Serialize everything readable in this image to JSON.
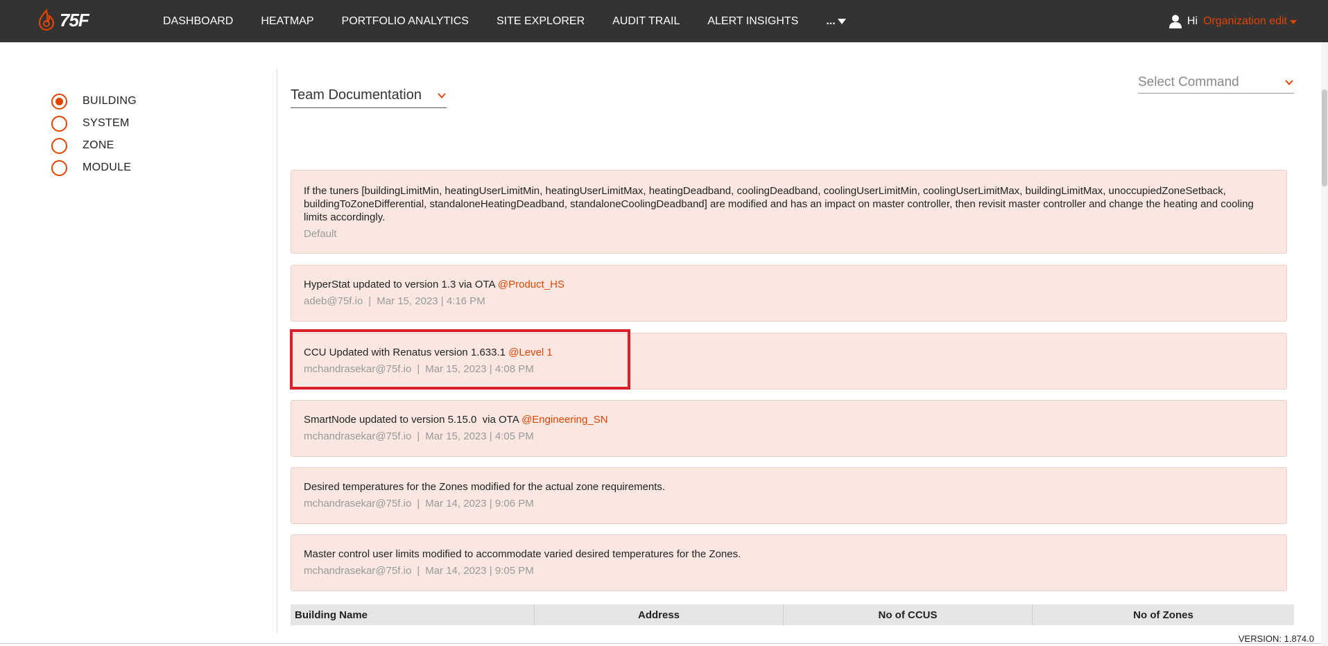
{
  "header": {
    "logo_text": "75F",
    "nav_items": [
      "DASHBOARD",
      "HEATMAP",
      "PORTFOLIO ANALYTICS",
      "SITE EXPLORER",
      "AUDIT TRAIL",
      "ALERT INSIGHTS"
    ],
    "more_label": "...",
    "greeting": "Hi",
    "org_label": "Organization edit"
  },
  "sidebar": {
    "options": [
      {
        "label": "BUILDING",
        "checked": true
      },
      {
        "label": "SYSTEM",
        "checked": false
      },
      {
        "label": "ZONE",
        "checked": false
      },
      {
        "label": "MODULE",
        "checked": false
      }
    ]
  },
  "team_select": {
    "value": "Team Documentation"
  },
  "command_select": {
    "placeholder": "Select Command"
  },
  "notes": [
    {
      "text": "If the tuners [buildingLimitMin, heatingUserLimitMin, heatingUserLimitMax, heatingDeadband, coolingDeadband, coolingUserLimitMin, coolingUserLimitMax, buildingLimitMax, unoccupiedZoneSetback, buildingToZoneDifferential, standaloneHeatingDeadband, standaloneCoolingDeadband] are modified and has an impact on master controller, then revisit master controller and change the heating and cooling limits accordingly.",
      "tag": "",
      "author": "Default",
      "date": ""
    },
    {
      "text": "HyperStat updated to version 1.3 via OTA ",
      "tag": "@Product_HS",
      "author": "adeb@75f.io",
      "date": "Mar 15, 2023 | 4:16 PM"
    },
    {
      "text": "CCU Updated with Renatus version 1.633.1 ",
      "tag": "@Level 1",
      "author": "mchandrasekar@75f.io",
      "date": "Mar 15, 2023 | 4:08 PM"
    },
    {
      "text": "SmartNode updated to version 5.15.0  via OTA ",
      "tag": "@Engineering_SN",
      "author": "mchandrasekar@75f.io",
      "date": "Mar 15, 2023 | 4:05 PM"
    },
    {
      "text": "Desired temperatures for the Zones modified for the actual zone requirements.",
      "tag": "",
      "author": "mchandrasekar@75f.io",
      "date": "Mar 14, 2023 | 9:06 PM"
    },
    {
      "text": "Master control user limits modified to accommodate varied desired temperatures for the Zones.",
      "tag": "",
      "author": "mchandrasekar@75f.io",
      "date": "Mar 14, 2023 | 9:05 PM"
    }
  ],
  "table": {
    "columns": [
      "Building Name",
      "Address",
      "No of CCUS",
      "No of Zones"
    ]
  },
  "footer": {
    "version": "VERSION: 1.874.0"
  },
  "colors": {
    "accent": "#e24301",
    "topbar": "#333333",
    "note_bg": "#fbe7e1",
    "highlight": "#d9202a"
  }
}
